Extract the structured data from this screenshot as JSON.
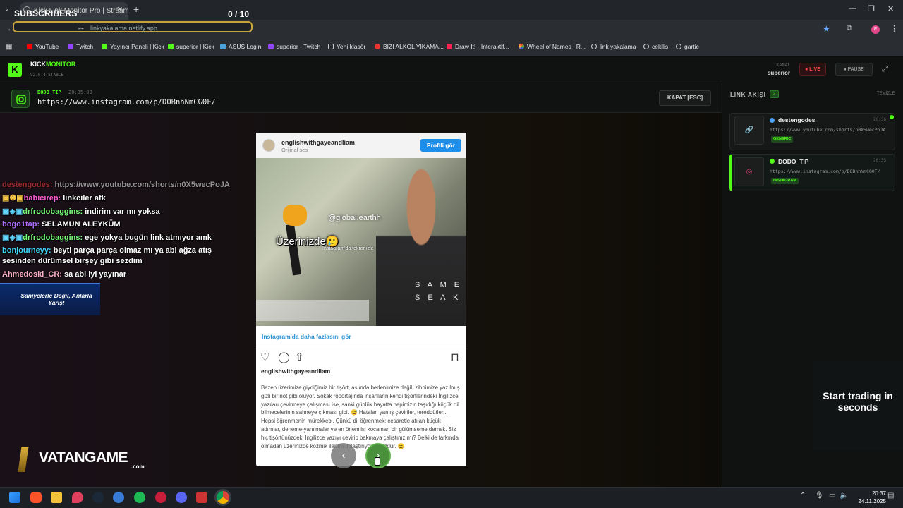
{
  "browser": {
    "tab_title": "Kick Link Monitor Pro | Stream",
    "url": "linkyakalama.netlify.app",
    "overlay_title": "SUBSCRIBERS",
    "overlay_count": "0  / 10",
    "bookmarks": [
      "YouTube",
      "Twitch",
      "Yayıncı Paneli | Kick",
      "superior | Kick",
      "ASUS Login",
      "superior - Twitch",
      "Yeni klasör",
      "BIZI ALKOL YIKAMA...",
      "Draw It! - İnteraktif...",
      "Wheel of Names | R...",
      "link yakalama",
      "cekilis",
      "gartic"
    ]
  },
  "app": {
    "logo_letter": "K",
    "brand_1": "KICK",
    "brand_2": "MONITOR",
    "version": "V2.0.4 STABLE",
    "kanal_label": "KANAL",
    "kanal_value": "superior",
    "live_label": "● LIVE",
    "pause_label": "⏸ PAUSE"
  },
  "linkbar": {
    "user": "DODO_TIP",
    "time": "20:35:03",
    "url": "https://www.instagram.com/p/DOBnhNmCG0F/",
    "close_label": "KAPAT [ESC]"
  },
  "chat": [
    {
      "user": "destengodes:",
      "text": "https://www.youtube.com/shorts/n0X5wecPoJA",
      "color": "#ff4040"
    },
    {
      "user": "babicirep:",
      "text": "linkciler afk",
      "color": "#ff5fd2"
    },
    {
      "user": "drfrodobaggins:",
      "text": "indirim var mı yoksa",
      "color": "#7cff7c"
    },
    {
      "user": "bogo1tap:",
      "text": "SELAMUN ALEYKÜM",
      "color": "#b06bff"
    },
    {
      "user": "drfrodobaggins:",
      "text": "ege yokya bugün link atmıyor amk",
      "color": "#7cff7c"
    },
    {
      "user": "bonjourneyy:",
      "text": "beyti parça parça olmaz mı ya abi ağza atış",
      "color": "#3fd9ff"
    },
    {
      "user": "",
      "text": "sesinden dürümsel birşey gibi sezdim",
      "color": "#ffffff"
    },
    {
      "user": "Ahmedoski_CR:",
      "text": "sa abi iyi yayınar",
      "color": "#ffb0c8"
    }
  ],
  "banner": {
    "text": "Saniyelerle Değil, Anlarla Yarış!"
  },
  "sponsor": {
    "name": "VATANGAME",
    "suffix": ".com"
  },
  "embed": {
    "username": "englishwithgayeandliam",
    "sub": "Orijinal ses",
    "profile_button": "Profili gör",
    "watermark": "@global.earthh",
    "caption_overlay": "Üzerinizde🥲",
    "caption_overlay_2": "Instagram'da tekrar izle",
    "shirt_text": "S A M E\nS E A K",
    "more_link": "Instagram'da daha fazlasını gör",
    "caption": "Bazen üzerimize giydiğimiz bir tişört, aslında bedenimize değil, zihnimize yazılmış gizli bir not gibi oluyor. Sokak röportajında insanların kendi tişörtlerindeki İngilizce yazıları çevirmeye çalışması ise, sanki günlük hayatta hepimizin taşıdığı küçük dil bilmecelerinin sahneye çıkması gibi. 😅 Hatalar, yanlış çeviriler, tereddütler... Hepsi öğrenmenin mürekkebi. Çünkü dil öğrenmek; cesaretle atılan küçük adımlar, deneme-yanılmalar ve en önemlisi kocaman bir gülümseme demek. Siz hiç tişörtünüzdeki İngilizce yazıyı çevirip bakmaya çalıştınız mı? Belki de farkında olmadan üzerinizde kozmik ilanını dolaştırıyorsunuzdur. 😄"
  },
  "panel": {
    "title": "LİNK AKIŞI",
    "count": "2",
    "clear": "TEMİZLE",
    "items": [
      {
        "user": "destengodes",
        "time": "20:36",
        "url": "https://www.youtube.com/shorts/n0X5wecPoJA",
        "tag": "GENERIC"
      },
      {
        "user": "DODO_TIP",
        "time": "20:35",
        "url": "https://www.instagram.com/p/DOBnhNmCG0F/",
        "tag": "INSTAGRAM"
      }
    ]
  },
  "ad": {
    "text": "Start trading in seconds"
  },
  "taskbar": {
    "time": "20:37",
    "date": "24.11.2025"
  }
}
